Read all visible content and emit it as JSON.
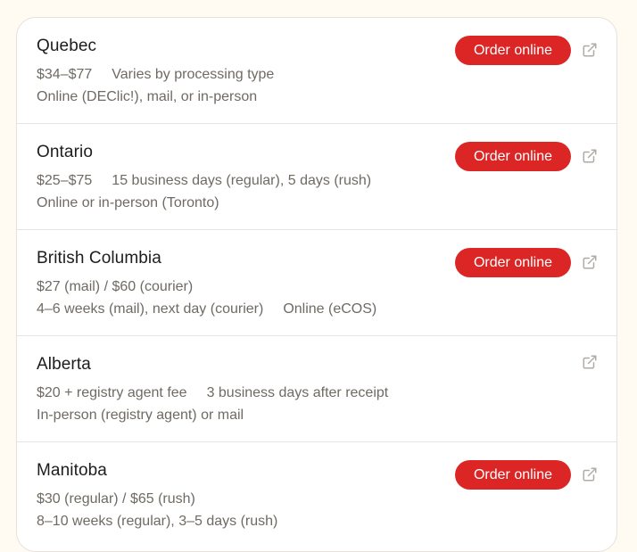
{
  "button_label": "Order online",
  "rows": [
    {
      "name": "Quebec",
      "line1": [
        "$34–$77",
        "Varies by processing type"
      ],
      "line2": [
        "Online (DEClic!), mail, or in-person"
      ],
      "has_order": true
    },
    {
      "name": "Ontario",
      "line1": [
        "$25–$75",
        "15 business days (regular), 5 days (rush)"
      ],
      "line2": [
        "Online or in-person (Toronto)"
      ],
      "has_order": true
    },
    {
      "name": "British Columbia",
      "line1": [
        "$27 (mail) / $60 (courier)"
      ],
      "line2": [
        "4–6 weeks (mail), next day (courier)",
        "Online (eCOS)"
      ],
      "has_order": true
    },
    {
      "name": "Alberta",
      "line1": [
        "$20 + registry agent fee",
        "3 business days after receipt"
      ],
      "line2": [
        "In-person (registry agent) or mail"
      ],
      "has_order": false
    },
    {
      "name": "Manitoba",
      "line1": [
        "$30 (regular) / $65 (rush)"
      ],
      "line2": [
        "8–10 weeks (regular), 3–5 days (rush)"
      ],
      "has_order": true
    }
  ],
  "icons": {
    "external": "external-link-icon"
  },
  "colors": {
    "accent": "#dc2626",
    "background": "#fffaf2",
    "text_primary": "#1d1d1d",
    "text_secondary": "#6f6a64"
  }
}
